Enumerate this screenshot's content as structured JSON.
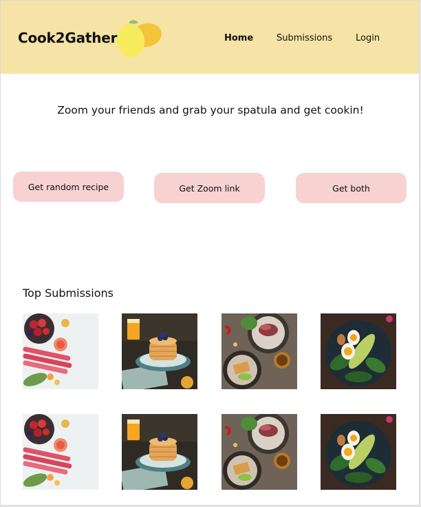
{
  "header": {
    "brand": "Cook2Gather",
    "logo_icon": "lemon-icon",
    "nav": {
      "home": "Home",
      "submissions": "Submissions",
      "login": "Login"
    },
    "background": "#f6e3a6"
  },
  "hero": {
    "tagline": "Zoom your friends and grab your spatula and get cookin!"
  },
  "actions": {
    "random_recipe": "Get random recipe",
    "zoom_link": "Get Zoom link",
    "both": "Get both",
    "button_color": "#f8d1d1"
  },
  "submissions": {
    "title": "Top Submissions",
    "photos": [
      "berries-rhubarb-photo",
      "pancakes-photo",
      "steak-salad-photo",
      "egg-avocado-photo",
      "berries-rhubarb-photo",
      "pancakes-photo",
      "steak-salad-photo",
      "egg-avocado-photo"
    ]
  }
}
